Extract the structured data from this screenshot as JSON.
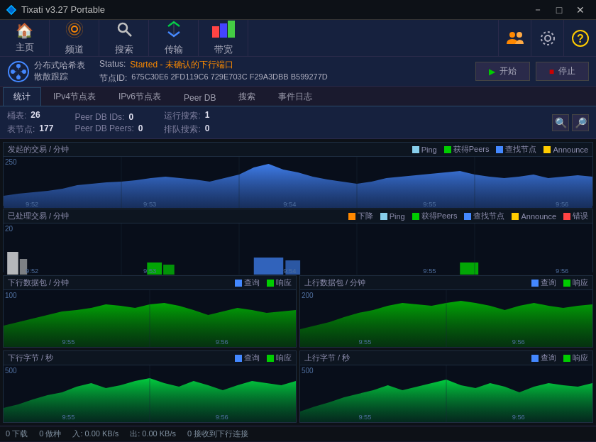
{
  "titlebar": {
    "title": "Tixati v3.27 Portable",
    "min_btn": "－",
    "max_btn": "□",
    "close_btn": "✕"
  },
  "navbar": {
    "items": [
      {
        "label": "主页",
        "icon": "🏠"
      },
      {
        "label": "频道",
        "icon": "📡"
      },
      {
        "label": "搜索",
        "icon": "🔍"
      },
      {
        "label": "传输",
        "icon": "⬆"
      },
      {
        "label": "带宽",
        "icon": "📊"
      }
    ],
    "right_icons": [
      "👥",
      "⚙",
      "❓"
    ]
  },
  "dht": {
    "title_line1": "分布式哈希表",
    "title_line2": "散散跟踪",
    "status_label": "Status:",
    "status_value": "Started - 未确认的下行端口",
    "nodeid_label": "节点ID:",
    "nodeid_value": "675C30E6 2FD119C6 729E703C F29A3DBB B599277D",
    "start_btn": "▶ 开始",
    "stop_btn": "■ 停止"
  },
  "tabs": [
    {
      "label": "统计",
      "active": true
    },
    {
      "label": "IPv4节点表"
    },
    {
      "label": "IPv6节点表"
    },
    {
      "label": "Peer DB"
    },
    {
      "label": "搜索"
    },
    {
      "label": "事件日志"
    }
  ],
  "stats": {
    "table_label": "桶表:",
    "table_val": "26",
    "node_label": "表节点:",
    "node_val": "177",
    "peer_db_ids_label": "Peer DB IDs:",
    "peer_db_ids_val": "0",
    "peer_db_peers_label": "Peer DB Peers:",
    "peer_db_peers_val": "0",
    "running_search_label": "运行搜索:",
    "running_search_val": "1",
    "queued_search_label": "排队搜索:",
    "queued_search_val": "0"
  },
  "chart1": {
    "title": "发起的交易 / 分钟",
    "ymax": "250",
    "times": [
      "9:52",
      "9:53",
      "9:54",
      "9:55",
      "9:56"
    ],
    "legend": [
      {
        "label": "Ping",
        "color": "#87ceeb"
      },
      {
        "label": "获得Peers",
        "color": "#00cc00"
      },
      {
        "label": "查找节点",
        "color": "#4488ff"
      },
      {
        "label": "Announce",
        "color": "#ffcc00"
      }
    ]
  },
  "chart2": {
    "title": "已处理交易 / 分钟",
    "ymax": "20",
    "times": [
      "9:52",
      "9:53",
      "9:54",
      "9:55",
      "9:56"
    ],
    "legend": [
      {
        "label": "下降",
        "color": "#ff8800"
      },
      {
        "label": "Ping",
        "color": "#87ceeb"
      },
      {
        "label": "获得Peers",
        "color": "#00cc00"
      },
      {
        "label": "查找节点",
        "color": "#4488ff"
      },
      {
        "label": "Announce",
        "color": "#ffcc00"
      },
      {
        "label": "错误",
        "color": "#ff4444"
      }
    ]
  },
  "chart3": {
    "title": "下行数据包 / 分钟",
    "ymax": "100",
    "times": [
      "9:55",
      "9:56"
    ],
    "legend": [
      {
        "label": "查询",
        "color": "#4488ff"
      },
      {
        "label": "响应",
        "color": "#00cc00"
      }
    ]
  },
  "chart4": {
    "title": "上行数据包 / 分钟",
    "ymax": "200",
    "times": [
      "9:55",
      "9:56"
    ],
    "legend": [
      {
        "label": "查询",
        "color": "#4488ff"
      },
      {
        "label": "响应",
        "color": "#00cc00"
      }
    ]
  },
  "chart5": {
    "title": "下行字节 / 秒",
    "ymax": "500",
    "times": [
      "9:55",
      "9:56"
    ],
    "legend": [
      {
        "label": "查询",
        "color": "#4488ff"
      },
      {
        "label": "响应",
        "color": "#00cc00"
      }
    ]
  },
  "chart6": {
    "title": "上行字节 / 秒",
    "ymax": "500",
    "times": [
      "9:55",
      "9:56"
    ],
    "legend": [
      {
        "label": "查询",
        "color": "#4488ff"
      },
      {
        "label": "响应",
        "color": "#00cc00"
      }
    ]
  },
  "statusbar": {
    "downloads": "0 下载",
    "seeds": "0 做种",
    "incoming": "入: 0.00 KB/s",
    "outgoing": "出: 0.00 KB/s",
    "connections": "0 接收到下行连接"
  }
}
